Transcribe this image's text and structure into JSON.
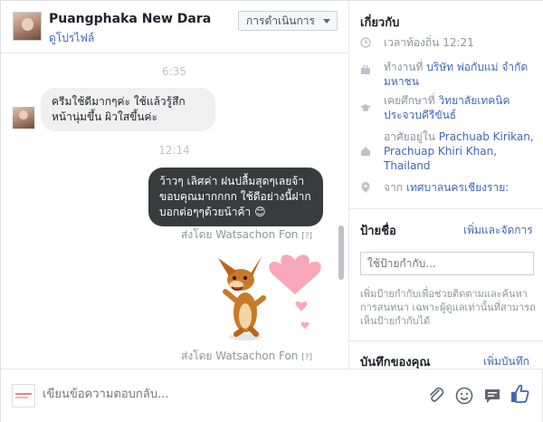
{
  "header": {
    "name": "Puangphaka New Dara",
    "profile_link": "ดูโปรไฟล์",
    "actions_label": "การดำเนินการ"
  },
  "messages": {
    "time1": "6:35",
    "incoming_text": "ครีมใช้ดีมากๆค่ะ ใช้แล้วรู้สึกหน้านุ่มขึ้น ผิวใสขึ้นค่ะ",
    "time2": "12:14",
    "outgoing_text": "ว้าวๆ เลิศค่า ฝนปลื้มสุดๆเลยจ้า ขอบคุณมากกกก ใช้ดีอย่างนี้ฝากบอกต่อๆๆด้วยน้าค้า",
    "outgoing_emoji": "😊",
    "sent_by_1": "ส่งโดย Watsachon Fon",
    "sent_by_2": "ส่งโดย Watsachon Fon",
    "help_mark": "[?]"
  },
  "about": {
    "title": "เกี่ยวกับ",
    "local_time": "เวลาท้องถิ่น 12:21",
    "work_prefix": "ทำงานที่",
    "work_link": "บริษัท พ่อกับแม่ จำกัด มหาชน",
    "study_prefix": "เคยศึกษาที่",
    "study_link": "วิทยาลัยเทคนิคประจวบคีรีขันธ์",
    "lives_prefix": "อาศัยอยู่ใน",
    "lives_link": "Prachuab Kirikan, Prachuap Khiri Khan, Thailand",
    "from_prefix": "จาก",
    "from_link": "เทศบาลนครเชียงราย:"
  },
  "labels": {
    "title": "ป้ายชื่อ",
    "manage_link": "เพิ่มและจัดการ",
    "input_placeholder": "ใช้ป้ายกำกับ...",
    "help_text": "เพิ่มป้ายกำกับเพื่อช่วยติดตามและค้นหาการสนทนา เฉพาะผู้ดูแลเท่านั้นที่สามารถเห็นป้ายกำกับได้"
  },
  "notes": {
    "title": "บันทึกของคุณ",
    "add_link": "เพิ่มบันทึก"
  },
  "compose": {
    "placeholder": "เขียนข้อความตอบกลับ..."
  },
  "colors": {
    "link": "#4267b2",
    "outgoing_bubble": "#3a3b3c",
    "incoming_bubble": "#f1f0f0",
    "like": "#4267b2",
    "heart": "#f7a8b8"
  }
}
